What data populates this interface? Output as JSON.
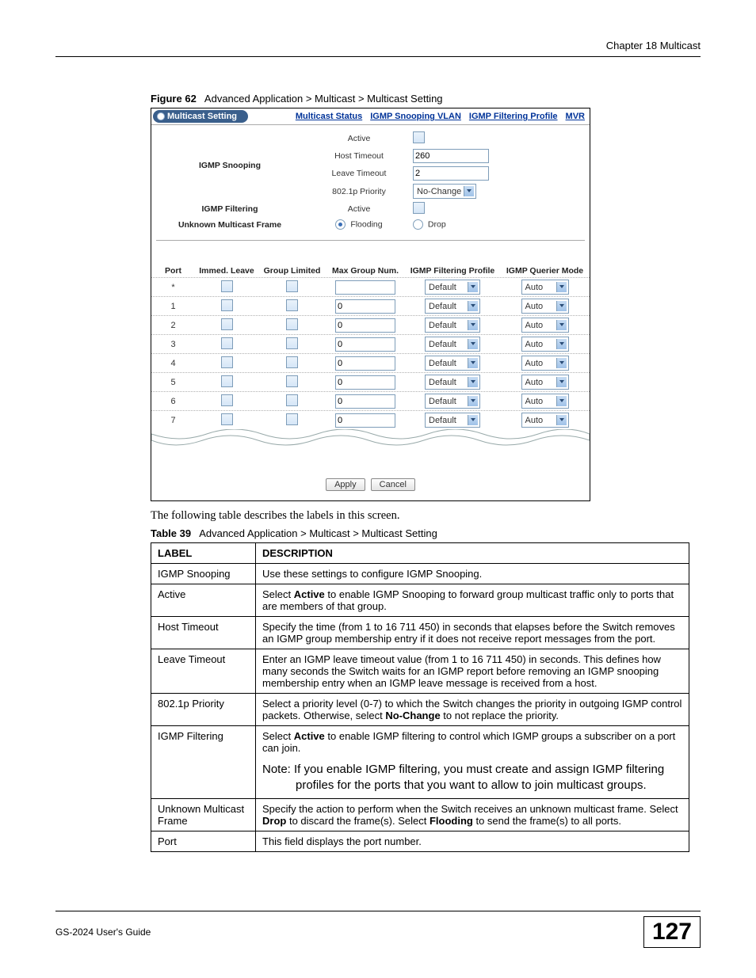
{
  "chapter_header": "Chapter 18 Multicast",
  "figure": {
    "label": "Figure 62",
    "title": "Advanced Application > Multicast > Multicast Setting"
  },
  "screenshot": {
    "tab_title": "Multicast Setting",
    "links": [
      "Multicast Status",
      "IGMP Snooping VLAN",
      "IGMP Filtering Profile",
      "MVR"
    ],
    "rows": {
      "igmp_snooping": "IGMP Snooping",
      "active": "Active",
      "host_timeout": "Host Timeout",
      "host_timeout_val": "260",
      "leave_timeout": "Leave Timeout",
      "leave_timeout_val": "2",
      "priority": "802.1p Priority",
      "priority_val": "No-Change",
      "igmp_filtering": "IGMP Filtering",
      "filtering_active": "Active",
      "unknown_frame": "Unknown Multicast Frame",
      "flooding": "Flooding",
      "drop": "Drop"
    },
    "port_headers": [
      "Port",
      "Immed. Leave",
      "Group Limited",
      "Max Group Num.",
      "IGMP Filtering Profile",
      "IGMP Querier Mode"
    ],
    "port_rows": [
      {
        "port": "*",
        "max": "",
        "profile": "Default",
        "mode": "Auto"
      },
      {
        "port": "1",
        "max": "0",
        "profile": "Default",
        "mode": "Auto"
      },
      {
        "port": "2",
        "max": "0",
        "profile": "Default",
        "mode": "Auto"
      },
      {
        "port": "3",
        "max": "0",
        "profile": "Default",
        "mode": "Auto"
      },
      {
        "port": "4",
        "max": "0",
        "profile": "Default",
        "mode": "Auto"
      },
      {
        "port": "5",
        "max": "0",
        "profile": "Default",
        "mode": "Auto"
      },
      {
        "port": "6",
        "max": "0",
        "profile": "Default",
        "mode": "Auto"
      },
      {
        "port": "7",
        "max": "0",
        "profile": "Default",
        "mode": "Auto"
      }
    ],
    "buttons": {
      "apply": "Apply",
      "cancel": "Cancel"
    }
  },
  "body_text": "The following table describes the labels in this screen.",
  "table": {
    "label": "Table 39",
    "title": "Advanced Application > Multicast > Multicast Setting",
    "head_label": "LABEL",
    "head_desc": "DESCRIPTION",
    "rows": [
      {
        "label": "IGMP Snooping",
        "desc": "Use these settings to configure IGMP Snooping."
      },
      {
        "label": "Active",
        "desc_html": "Select <b>Active</b> to enable IGMP Snooping to forward group multicast traffic only to ports that are members of that group."
      },
      {
        "label": "Host Timeout",
        "desc": "Specify the time (from 1 to 16 711 450) in seconds that elapses before the Switch removes an IGMP group membership entry if it does not receive report messages from the port."
      },
      {
        "label": "Leave Timeout",
        "desc": "Enter an IGMP leave timeout value (from 1 to 16 711 450) in seconds. This defines how many seconds the Switch waits for an IGMP report before removing an IGMP snooping membership entry when an IGMP leave message is received from a host."
      },
      {
        "label": "802.1p Priority",
        "desc_html": "Select a priority level (0-7) to which the Switch changes the priority in outgoing IGMP control packets. Otherwise, select <b>No-Change</b> to not replace the priority."
      },
      {
        "label": "IGMP Filtering",
        "desc_html": "Select <b>Active</b> to enable IGMP filtering to control which IGMP groups a subscriber on a port can join.",
        "note": "Note: If you enable IGMP filtering, you must create and assign IGMP filtering profiles for the ports that you want to allow to join multicast groups."
      },
      {
        "label": "Unknown Multicast Frame",
        "desc_html": "Specify the action to perform when the Switch receives an unknown multicast frame. Select <b>Drop</b> to discard the frame(s). Select <b>Flooding</b> to send the frame(s) to all ports."
      },
      {
        "label": "Port",
        "desc": "This field displays the port number."
      }
    ]
  },
  "footer": {
    "guide": "GS-2024 User's Guide",
    "page": "127"
  }
}
